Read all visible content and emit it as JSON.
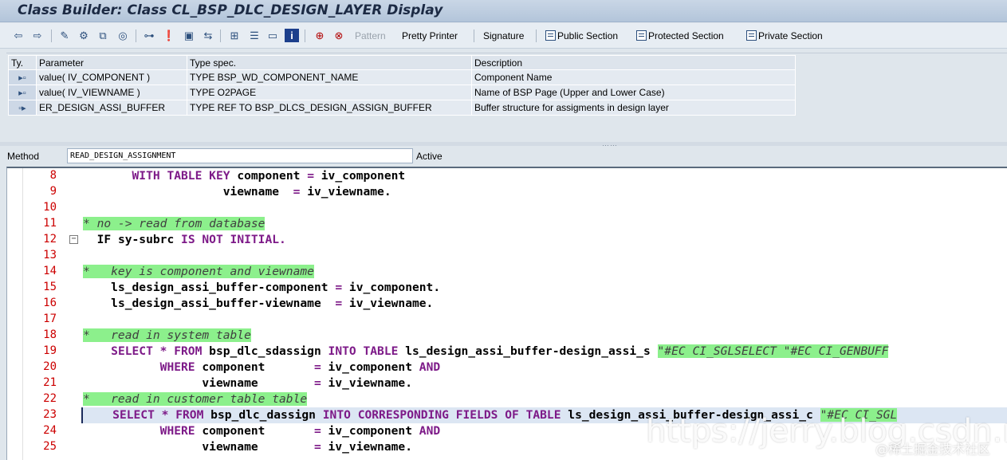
{
  "window": {
    "title": "Class Builder: Class CL_BSP_DLC_DESIGN_LAYER Display"
  },
  "toolbar": {
    "pattern": "Pattern",
    "pretty_printer": "Pretty Printer",
    "signature": "Signature",
    "public_section": "Public Section",
    "protected_section": "Protected Section",
    "private_section": "Private Section"
  },
  "params": {
    "headers": {
      "ty": "Ty.",
      "parameter": "Parameter",
      "type_spec": "Type spec.",
      "description": "Description"
    },
    "rows": [
      {
        "ty": "importing-icon",
        "parameter": "value( IV_COMPONENT )",
        "type_spec": "TYPE BSP_WD_COMPONENT_NAME",
        "description": "Component Name"
      },
      {
        "ty": "importing-icon",
        "parameter": "value( IV_VIEWNAME )",
        "type_spec": "TYPE O2PAGE",
        "description": "Name of BSP Page (Upper and Lower Case)"
      },
      {
        "ty": "exporting-icon",
        "parameter": "ER_DESIGN_ASSI_BUFFER",
        "type_spec": "TYPE REF TO BSP_DLCS_DESIGN_ASSIGN_BUFFER",
        "description": "Buffer structure for assigments in design layer"
      }
    ]
  },
  "method": {
    "label": "Method",
    "name": "READ_DESIGN_ASSIGNMENT",
    "status": "Active"
  },
  "editor": {
    "lines": [
      {
        "n": "8"
      },
      {
        "n": "9"
      },
      {
        "n": "10"
      },
      {
        "n": "11"
      },
      {
        "n": "12"
      },
      {
        "n": "13"
      },
      {
        "n": "14"
      },
      {
        "n": "15"
      },
      {
        "n": "16"
      },
      {
        "n": "17"
      },
      {
        "n": "18"
      },
      {
        "n": "19"
      },
      {
        "n": "20"
      },
      {
        "n": "21"
      },
      {
        "n": "22"
      },
      {
        "n": "23"
      },
      {
        "n": "24"
      },
      {
        "n": "25"
      }
    ],
    "code": {
      "l8_a": "WITH TABLE KEY",
      "l8_b": " component ",
      "l8_c": "=",
      "l8_d": " iv_component",
      "l9_a": "viewname  ",
      "l9_b": "=",
      "l9_c": " iv_viewname.",
      "l11": "* no -> read from database",
      "l12_a": "IF",
      "l12_b": " sy-subrc ",
      "l12_c": "IS NOT INITIAL",
      "l12_d": ".",
      "l14": "*   key is component and viewname",
      "l15_a": "ls_design_assi_buffer-component ",
      "l15_b": "=",
      "l15_c": " iv_component.",
      "l16_a": "ls_design_assi_buffer-viewname  ",
      "l16_b": "=",
      "l16_c": " iv_viewname.",
      "l18": "*   read in system table",
      "l19_a": "SELECT * FROM",
      "l19_b": " bsp_dlc_sdassign ",
      "l19_c": "INTO TABLE",
      "l19_d": " ls_design_assi_buffer-design_assi_s ",
      "l19_e": "\"#EC CI_SGLSELECT \"#EC CI_GENBUFF",
      "l20_a": "WHERE",
      "l20_b": " component       ",
      "l20_c": "=",
      "l20_d": " iv_component ",
      "l20_e": "AND",
      "l21_a": "viewname        ",
      "l21_b": "=",
      "l21_c": " iv_viewname.",
      "l22": "*   read in customer table table",
      "l23_a": "SELECT * FROM",
      "l23_b": " bsp_dlc_dassign ",
      "l23_c": "INTO CORRESPONDING FIELDS OF TABLE",
      "l23_d": " ls_design_assi_buffer-design_assi_c ",
      "l23_e": "\"#EC CI_SGL",
      "l24_a": "WHERE",
      "l24_b": " component       ",
      "l24_c": "=",
      "l24_d": " iv_component ",
      "l24_e": "AND",
      "l25_a": "viewname        ",
      "l25_b": "=",
      "l25_c": " iv_viewname."
    }
  },
  "watermark": {
    "url": "https://jerry.blog.csdn.net",
    "site": "@稀土掘金技术社区"
  }
}
